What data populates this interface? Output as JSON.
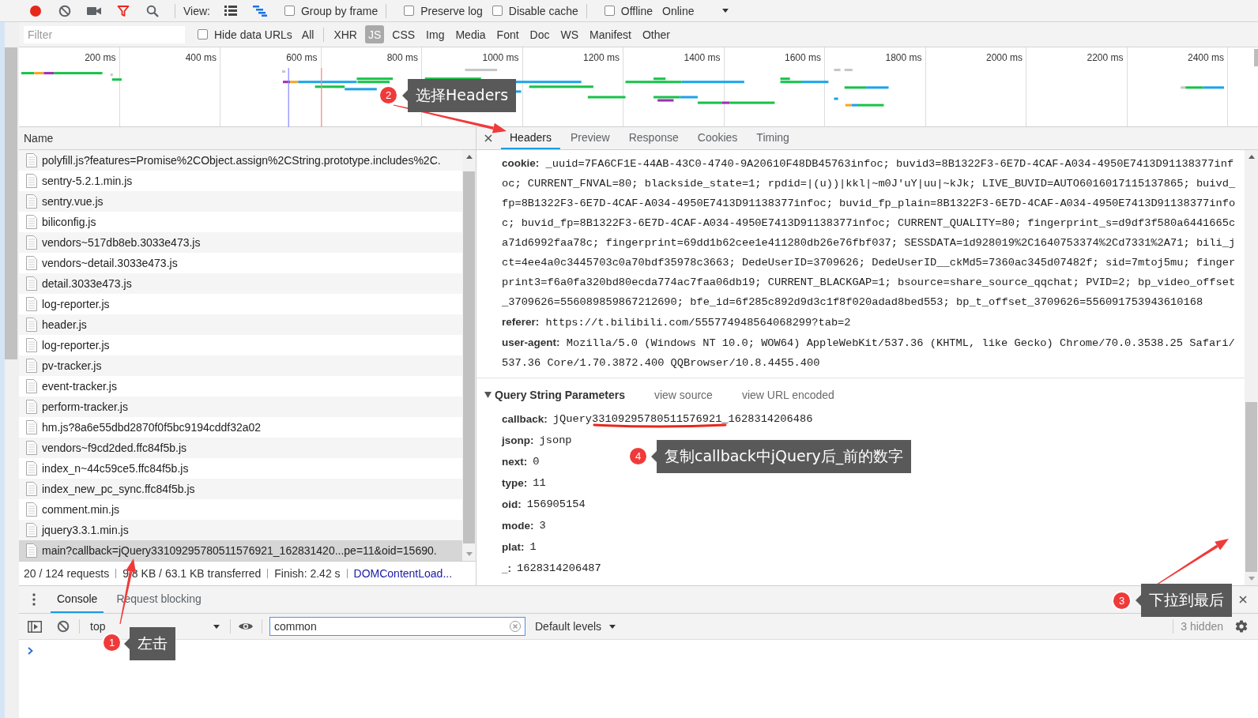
{
  "toolbar": {
    "buttons": [
      {
        "kind": "record",
        "on": true
      },
      {
        "kind": "clear"
      },
      {
        "kind": "camera",
        "on": false
      },
      {
        "kind": "filter",
        "on": true
      },
      {
        "kind": "search"
      }
    ],
    "view_label": "View:",
    "view_toggles": [
      {
        "kind": "large-rows",
        "on": false
      },
      {
        "kind": "overview",
        "on": true
      }
    ],
    "checkboxes": [
      {
        "label": "Group by frame",
        "checked": false
      },
      {
        "label": "Preserve log",
        "checked": false
      },
      {
        "label": "Disable cache",
        "checked": false
      },
      {
        "label": "Offline",
        "checked": false
      }
    ],
    "throttling": "Online"
  },
  "filter_bar": {
    "placeholder": "Filter",
    "hide_data_urls": {
      "label": "Hide data URLs",
      "checked": false
    },
    "types": [
      {
        "label": "All",
        "selected": false
      },
      {
        "label": "XHR",
        "selected": false
      },
      {
        "label": "JS",
        "selected": true
      },
      {
        "label": "CSS",
        "selected": false
      },
      {
        "label": "Img",
        "selected": false
      },
      {
        "label": "Media",
        "selected": false
      },
      {
        "label": "Font",
        "selected": false
      },
      {
        "label": "Doc",
        "selected": false
      },
      {
        "label": "WS",
        "selected": false
      },
      {
        "label": "Manifest",
        "selected": false
      },
      {
        "label": "Other",
        "selected": false
      }
    ]
  },
  "timeline": {
    "ticks": [
      "200 ms",
      "400 ms",
      "600 ms",
      "800 ms",
      "1000 ms",
      "1200 ms",
      "1400 ms",
      "1600 ms",
      "1800 ms",
      "2000 ms",
      "2200 ms",
      "2400 ms"
    ]
  },
  "requests": {
    "column": "Name",
    "rows": [
      {
        "name": "polyfill.js?features=Promise%2CObject.assign%2CString.prototype.includes%2C.",
        "selected": false
      },
      {
        "name": "sentry-5.2.1.min.js",
        "selected": false
      },
      {
        "name": "sentry.vue.js",
        "selected": false
      },
      {
        "name": "biliconfig.js",
        "selected": false
      },
      {
        "name": "vendors~517db8eb.3033e473.js",
        "selected": false
      },
      {
        "name": "vendors~detail.3033e473.js",
        "selected": false
      },
      {
        "name": "detail.3033e473.js",
        "selected": false
      },
      {
        "name": "log-reporter.js",
        "selected": false
      },
      {
        "name": "header.js",
        "selected": false
      },
      {
        "name": "log-reporter.js",
        "selected": false
      },
      {
        "name": "pv-tracker.js",
        "selected": false
      },
      {
        "name": "event-tracker.js",
        "selected": false
      },
      {
        "name": "perform-tracker.js",
        "selected": false
      },
      {
        "name": "hm.js?8a6e55dbd2870f0f5bc9194cddf32a02",
        "selected": false
      },
      {
        "name": "vendors~f9cd2ded.ffc84f5b.js",
        "selected": false
      },
      {
        "name": "index_n~44c59ce5.ffc84f5b.js",
        "selected": false
      },
      {
        "name": "index_new_pc_sync.ffc84f5b.js",
        "selected": false
      },
      {
        "name": "comment.min.js",
        "selected": false
      },
      {
        "name": "jquery3.3.1.min.js",
        "selected": false
      },
      {
        "name": "main?callback=jQuery33109295780511576921_162831420...pe=11&oid=15690.",
        "selected": true
      }
    ]
  },
  "status_bar": {
    "requests": "20 / 124 requests",
    "transferred": "9.8 KB / 63.1 KB transferred",
    "finish": "Finish: 2.42 s",
    "dom_content_loaded": "DOMContentLoad..."
  },
  "details": {
    "tabs": [
      {
        "label": "Headers",
        "selected": true
      },
      {
        "label": "Preview",
        "selected": false
      },
      {
        "label": "Response",
        "selected": false
      },
      {
        "label": "Cookies",
        "selected": false
      },
      {
        "label": "Timing",
        "selected": false
      }
    ],
    "headers": [
      {
        "name": "cookie:",
        "value": "_uuid=7FA6CF1E-44AB-43C0-4740-9A20610F48DB45763infoc; buvid3=8B1322F3-6E7D-4CAF-A034-4950E7413D91138377infoc; CURRENT_FNVAL=80; blackside_state=1; rpdid=|(u))|kkl|~m0J'uY|uu|~kJk; LIVE_BUVID=AUTO6016017115137865; buivd_fp=8B1322F3-6E7D-4CAF-A034-4950E7413D91138377infoc; buvid_fp_plain=8B1322F3-6E7D-4CAF-A034-4950E7413D91138377infoc; buvid_fp=8B1322F3-6E7D-4CAF-A034-4950E7413D91138377infoc; CURRENT_QUALITY=80; fingerprint_s=d9df3f580a6441665ca71d6992faa78c; fingerprint=69dd1b62cee1e411280db26e76fbf037; SESSDATA=1d928019%2C1640753374%2Cd7331%2A71; bili_jct=4ee4a0c3445703c0a70bdf35978c3663; DedeUserID=3709626; DedeUserID__ckMd5=7360ac345d07482f; sid=7mtoj5mu; fingerprint3=f6a0fa320bd80ecda774ac7faa06db19; CURRENT_BLACKGAP=1; bsource=share_source_qqchat; PVID=2; bp_video_offset_3709626=556089859867212690; bfe_id=6f285c892d9d3c1f8f020adad8bed553; bp_t_offset_3709626=556091753943610168"
      },
      {
        "name": "referer:",
        "value": "https://t.bilibili.com/555774948564068299?tab=2"
      },
      {
        "name": "user-agent:",
        "value": "Mozilla/5.0 (Windows NT 10.0; WOW64) AppleWebKit/537.36 (KHTML, like Gecko) Chrome/70.0.3538.25 Safari/537.36 Core/1.70.3872.400 QQBrowser/10.8.4455.400"
      }
    ],
    "query_string": {
      "title": "Query String Parameters",
      "expanded": true,
      "links": [
        "view source",
        "view URL encoded"
      ],
      "params": [
        {
          "name": "callback:",
          "value": "jQuery33109295780511576921_1628314206486"
        },
        {
          "name": "jsonp:",
          "value": "jsonp"
        },
        {
          "name": "next:",
          "value": "0"
        },
        {
          "name": "type:",
          "value": "11"
        },
        {
          "name": "oid:",
          "value": "156905154"
        },
        {
          "name": "mode:",
          "value": "3"
        },
        {
          "name": "plat:",
          "value": "1"
        },
        {
          "name": "_:",
          "value": "1628314206487"
        }
      ]
    }
  },
  "drawer": {
    "tabs": [
      {
        "label": "Console",
        "selected": true
      },
      {
        "label": "Request blocking",
        "selected": false
      }
    ],
    "context": "top",
    "filter_value": "common",
    "levels": "Default levels",
    "hidden": "3 hidden"
  },
  "annotations": [
    {
      "number": "1",
      "text": "左击"
    },
    {
      "number": "2",
      "text": "选择Headers"
    },
    {
      "number": "3",
      "text": "下拉到最后"
    },
    {
      "number": "4",
      "text": "复制callback中jQuery后_前的数字"
    }
  ]
}
